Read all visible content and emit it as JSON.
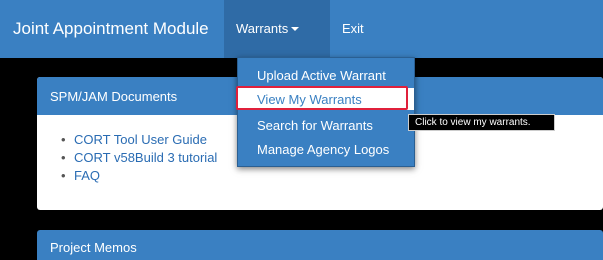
{
  "navbar": {
    "brand": "Joint Appointment Module",
    "warrants_label": "Warrants",
    "exit_label": "Exit"
  },
  "dropdown": {
    "items": [
      {
        "label": "Upload Active Warrant"
      },
      {
        "label": "View My Warrants"
      },
      {
        "label": "Search for Warrants"
      },
      {
        "label": "Manage Agency Logos"
      }
    ]
  },
  "tooltip": {
    "text": "Click to view my warrants."
  },
  "panel": {
    "title": "SPM/JAM Documents",
    "links": [
      {
        "label": "CORT Tool User Guide"
      },
      {
        "label": "CORT v58Build 3 tutorial"
      },
      {
        "label": "FAQ"
      }
    ]
  },
  "panel2": {
    "title": "Project Memos"
  },
  "colors": {
    "nav_blue": "#3a80c2",
    "nav_active": "#2f6ba6",
    "highlight_red": "#e0203b",
    "link_blue": "#2a6cb3",
    "background": "#000000"
  },
  "icons": {
    "caret": "chevron-down-icon"
  }
}
